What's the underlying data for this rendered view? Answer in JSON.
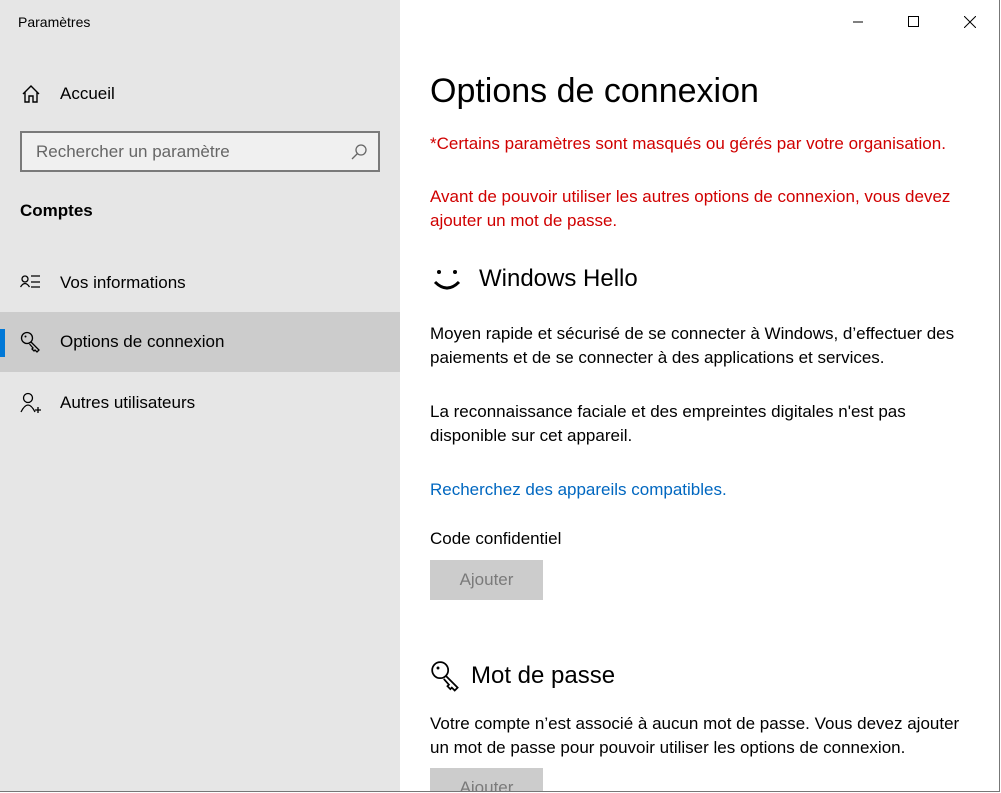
{
  "window": {
    "title": "Paramètres",
    "controls": [
      "minimize",
      "maximize",
      "close"
    ]
  },
  "sidebar": {
    "home": "Accueil",
    "search_placeholder": "Rechercher un paramètre",
    "category": "Comptes",
    "items": [
      {
        "label": "Vos informations",
        "icon": "person-list-icon"
      },
      {
        "label": "Options de connexion",
        "icon": "key-icon",
        "selected": true
      },
      {
        "label": "Autres utilisateurs",
        "icon": "person-add-icon"
      }
    ]
  },
  "main": {
    "title": "Options de connexion",
    "warning1": "*Certains paramètres sont masqués ou gérés par votre organisation.",
    "warning2": "Avant de pouvoir utiliser les autres options de connexion, vous devez ajouter un mot de passe.",
    "hello": {
      "title": "Windows Hello",
      "desc": "Moyen rapide et sécurisé de se connecter à Windows, d’effectuer des paiements et de se connecter à des applications et services.",
      "unavailable": "La reconnaissance faciale et des empreintes digitales n'est pas disponible sur cet appareil.",
      "link": "Recherchez des appareils compatibles.",
      "pin_label": "Code confidentiel",
      "pin_button": "Ajouter"
    },
    "password": {
      "title": "Mot de passe",
      "desc": "Votre compte n’est associé à aucun mot de passe. Vous devez ajouter un mot de passe pour pouvoir utiliser les options de connexion.",
      "button": "Ajouter"
    }
  },
  "colors": {
    "accent": "#0078d7",
    "warning": "#d00000",
    "link": "#0067c0"
  }
}
